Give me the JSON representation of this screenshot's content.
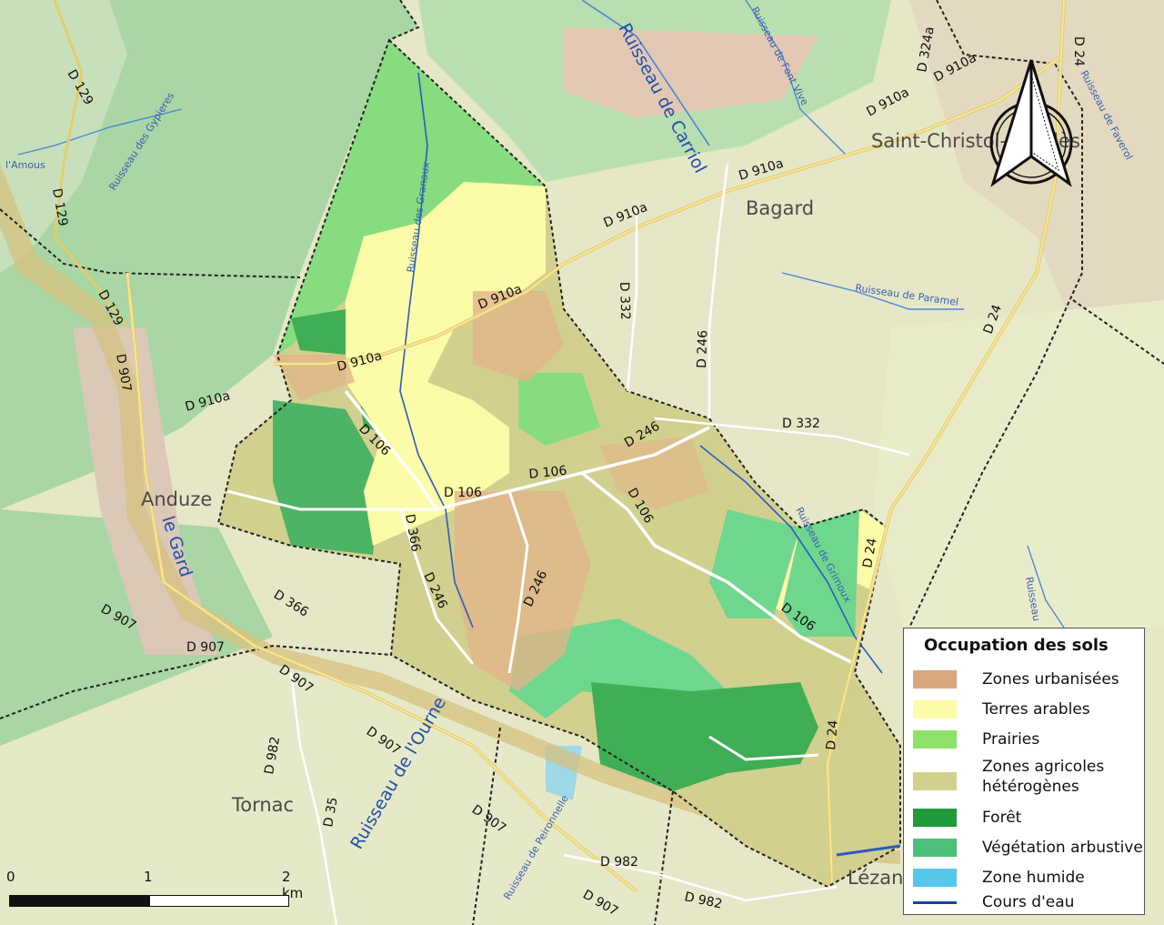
{
  "legend": {
    "title": "Occupation des sols",
    "items": [
      {
        "label": "Zones urbanisées",
        "color": "#d9a77d"
      },
      {
        "label": "Terres arables",
        "color": "#fcfba8"
      },
      {
        "label": "Prairies",
        "color": "#8ee26a"
      },
      {
        "label": "Zones agricoles\nhétérogènes",
        "color": "#d2d08f"
      },
      {
        "label": "Forêt",
        "color": "#1f9a3d"
      },
      {
        "label": "Végétation arbustive",
        "color": "#4cbf7a"
      },
      {
        "label": "Zone humide",
        "color": "#55c8ea"
      },
      {
        "label": "Cours d'eau",
        "color": "#1a3ea8"
      }
    ]
  },
  "scale": {
    "labels": [
      "0",
      "1",
      "2 km"
    ]
  },
  "places": {
    "anduze": "Anduze",
    "tornac": "Tornac",
    "bagard": "Bagard",
    "saint_christol": "Saint-Christol-lès-Alès",
    "lezan": "Lézan"
  },
  "rivers": {
    "carriol": "Ruisseau de Carriol",
    "ourne": "Ruisseau de l'Ourne",
    "gard": "le Gard",
    "font_vive": "Ruisseau de Font Vive",
    "gypieres": "Ruisseau des Gypieres",
    "granaux": "Ruisseau des Granaux",
    "paramel": "Ruisseau de Paramel",
    "grimoux": "Ruisseau de Grimoux",
    "faverol": "Ruisseau de Faverol",
    "amous": "l'Amous",
    "peironnelle": "Ruisseau de Peironnelle",
    "ruisseau_right": "Ruisseau"
  },
  "roads": {
    "d910a": "D 910a",
    "d106": "D 106",
    "d246": "D 246",
    "d332": "D 332",
    "d24": "D 24",
    "d907": "D 907",
    "d129": "D 129",
    "d366": "D 366",
    "d982": "D 982",
    "d35": "D 35",
    "d324a": "D 324a"
  },
  "north_arrow": "north-arrow-icon"
}
